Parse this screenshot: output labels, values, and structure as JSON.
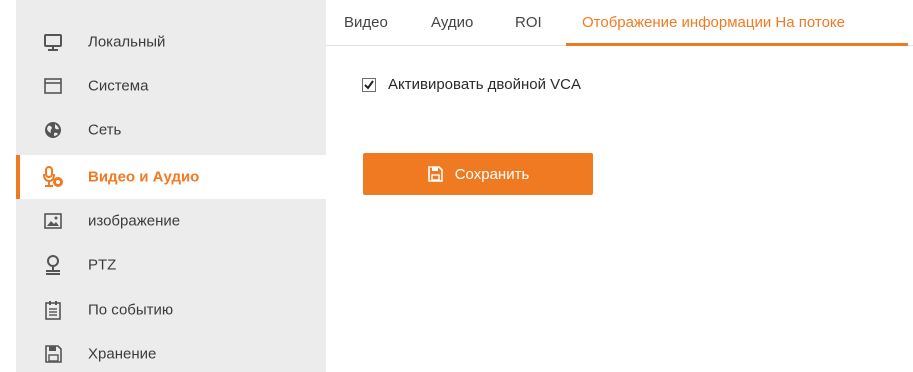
{
  "sidebar": {
    "items": [
      {
        "label": "Локальный",
        "icon": "monitor-icon"
      },
      {
        "label": "Система",
        "icon": "window-icon"
      },
      {
        "label": "Сеть",
        "icon": "globe-icon"
      },
      {
        "label": "Видео и Аудио",
        "icon": "mic-camera-icon",
        "active": true
      },
      {
        "label": "изображение",
        "icon": "image-icon"
      },
      {
        "label": "PTZ",
        "icon": "ptz-icon"
      },
      {
        "label": "По событию",
        "icon": "calendar-icon"
      },
      {
        "label": "Хранение",
        "icon": "floppy-icon"
      }
    ]
  },
  "tabs": [
    {
      "label": "Видео"
    },
    {
      "label": "Аудио"
    },
    {
      "label": "ROI"
    },
    {
      "label": "Отображение информации На потоке",
      "active": true
    }
  ],
  "form": {
    "dual_vca_label": "Активировать двойной VCA",
    "dual_vca_checked": true
  },
  "save_button": {
    "label": "Сохранить",
    "icon": "floppy-icon"
  },
  "colors": {
    "accent": "#f07a22",
    "sidebar_bg": "#ececec",
    "text": "#333333"
  }
}
